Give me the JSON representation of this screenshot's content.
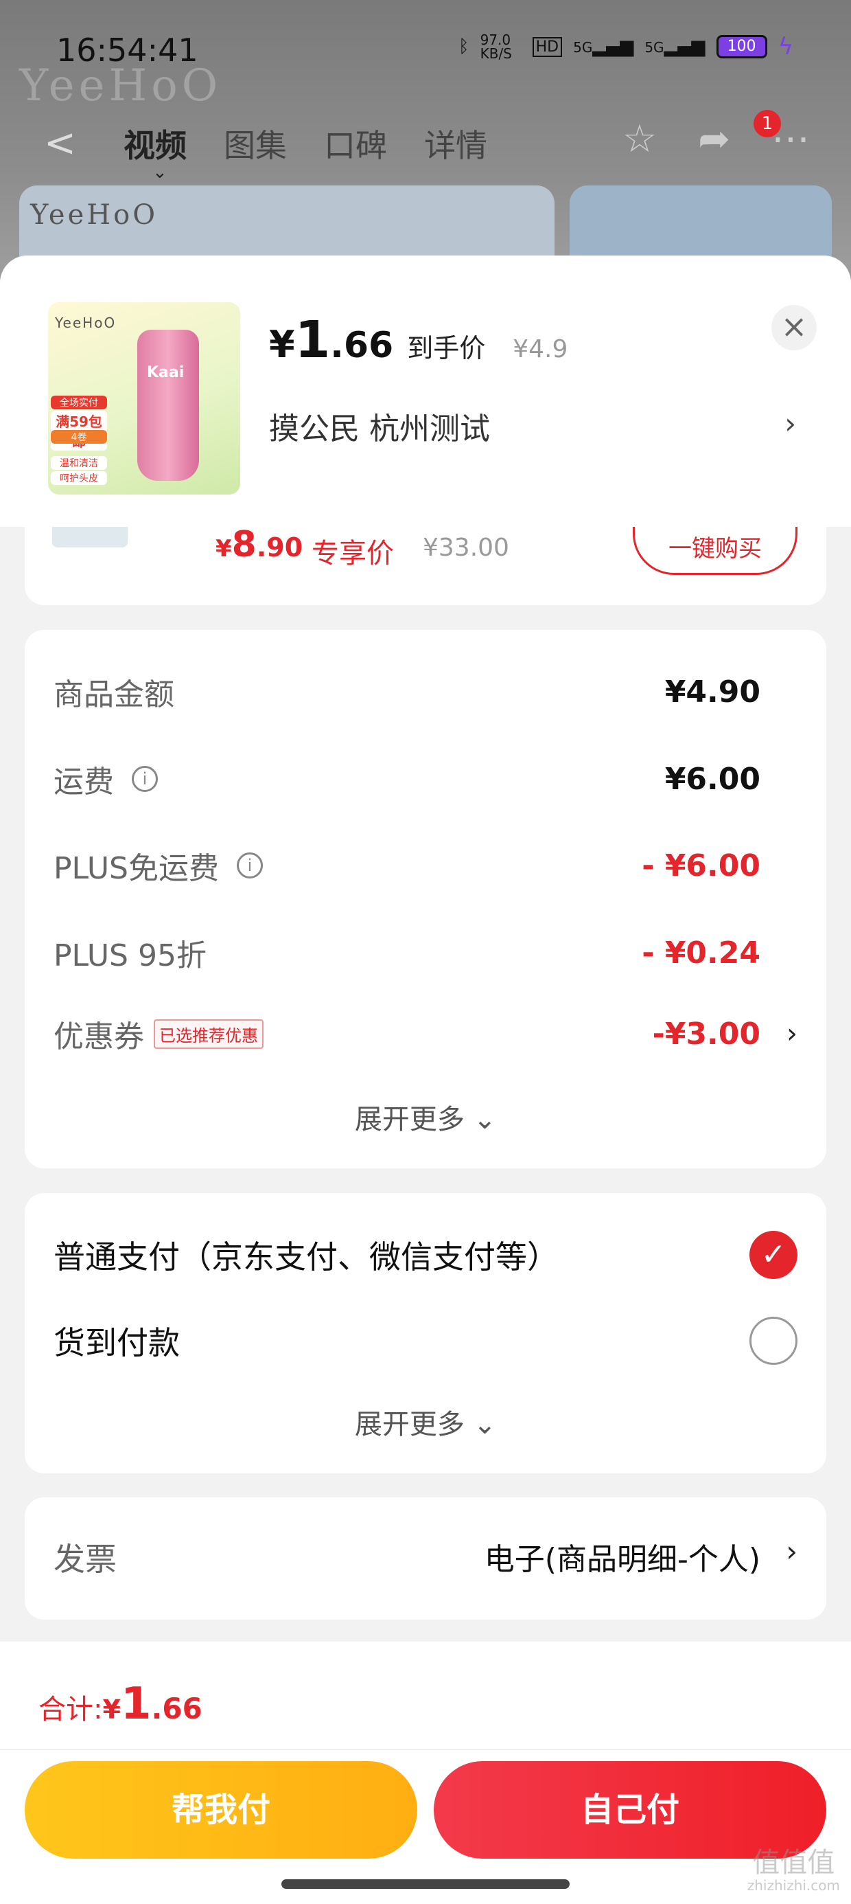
{
  "status_bar": {
    "time": "16:54:41",
    "net_speed": "97.0 KB/S",
    "hd": "HD",
    "sig1": "5G",
    "sig2": "5G",
    "battery": "100"
  },
  "background": {
    "brand": "YeeHoO",
    "tabs": [
      "视频",
      "图集",
      "口碑",
      "详情"
    ],
    "notification_count": "1"
  },
  "product": {
    "brand": "YeeHoO",
    "tube_label": "Kaai",
    "thumb_tags": [
      "全场实付",
      "满59包邮",
      "4卷",
      "温和清洁",
      "呵护头皮"
    ],
    "price_yen": "¥",
    "price_int": "1",
    "price_dec": ".66",
    "price_tag": "到手价",
    "original_price": "¥4.9",
    "address": "摸公民  杭州测试"
  },
  "promo": {
    "price_yen": "¥",
    "price_int": "8",
    "price_dec": ".90",
    "tag": "专享价",
    "original": "¥33.00",
    "buy_label": "一键购买"
  },
  "amounts": {
    "rows": [
      {
        "label": "商品金额",
        "value": "¥4.90"
      },
      {
        "label": "运费",
        "value": "¥6.00"
      },
      {
        "label": "PLUS免运费",
        "value": "- ¥6.00"
      },
      {
        "label": "PLUS 95折",
        "value": "- ¥0.24"
      },
      {
        "label": "优惠券",
        "badge": "已选推荐优惠",
        "value": "-¥3.00"
      }
    ],
    "expand_label": "展开更多"
  },
  "payment": {
    "options": [
      {
        "label": "普通支付（京东支付、微信支付等）",
        "selected": true
      },
      {
        "label": "货到付款",
        "selected": false
      }
    ],
    "expand_label": "展开更多"
  },
  "invoice": {
    "label": "发票",
    "value": "电子(商品明细-个人)"
  },
  "footer": {
    "total_label": "合计: ",
    "total_yen": "¥",
    "total_int": "1",
    "total_dec": ".66",
    "help_pay": "帮我付",
    "self_pay": "自己付"
  },
  "watermark": {
    "text": "值值值",
    "url": "zhizhizhi.com"
  },
  "colors": {
    "accent_red": "#e4252b",
    "accent_yellow": "#ffb915"
  }
}
